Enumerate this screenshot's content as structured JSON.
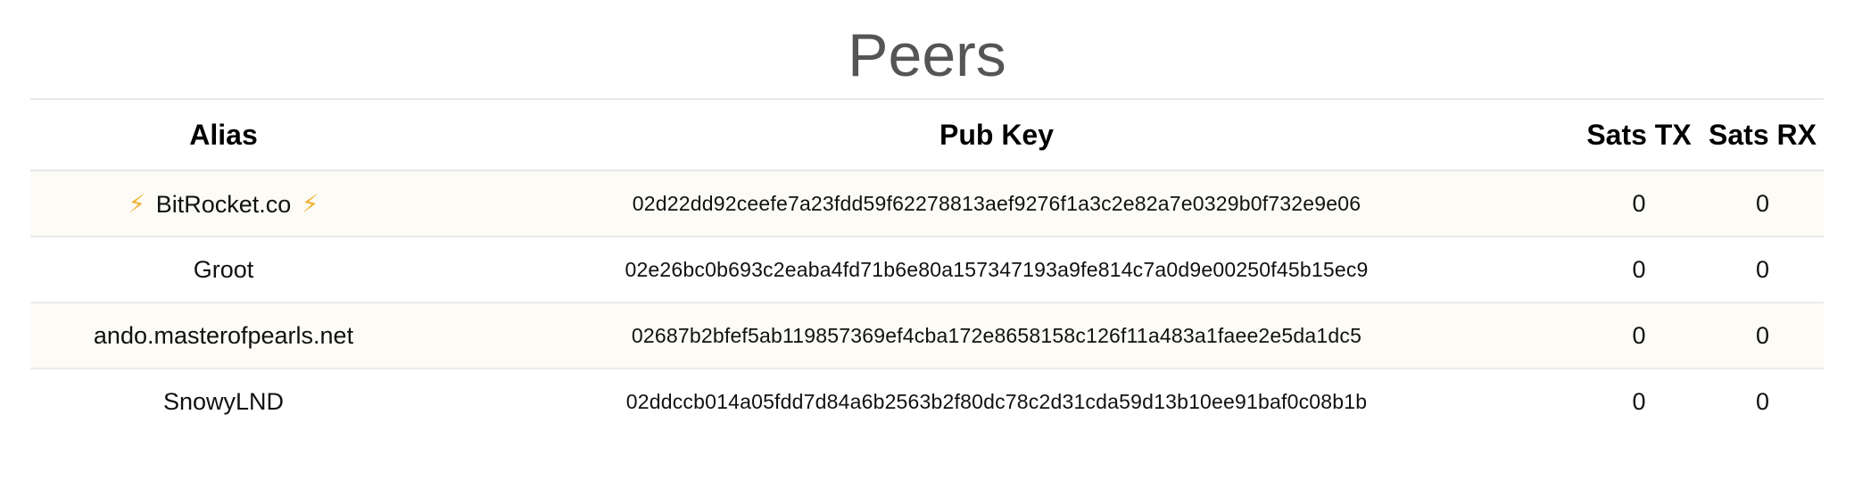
{
  "page": {
    "title": "Peers"
  },
  "table": {
    "headers": {
      "alias": "Alias",
      "pubkey": "Pub Key",
      "sats_tx": "Sats TX",
      "sats_rx": "Sats RX"
    },
    "rows": [
      {
        "alias_prefix_icon": "⚡",
        "alias": "BitRocket.co",
        "alias_suffix_icon": "⚡",
        "pubkey": "02d22dd92ceefe7a23fdd59f62278813aef9276f1a3c2e82a7e0329b0f732e9e06",
        "sats_tx": "0",
        "sats_rx": "0"
      },
      {
        "alias": "Groot",
        "pubkey": "02e26bc0b693c2eaba4fd71b6e80a157347193a9fe814c7a0d9e00250f45b15ec9",
        "sats_tx": "0",
        "sats_rx": "0"
      },
      {
        "alias": "ando.masterofpearls.net",
        "pubkey": "02687b2bfef5ab119857369ef4cba172e8658158c126f11a483a1faee2e5da1dc5",
        "sats_tx": "0",
        "sats_rx": "0"
      },
      {
        "alias": "SnowyLND",
        "pubkey": "02ddccb014a05fdd7d84a6b2563b2f80dc78c2d31cda59d13b10ee91baf0c08b1b",
        "sats_tx": "0",
        "sats_rx": "0"
      }
    ]
  },
  "colors": {
    "title": "#555555",
    "row_stripe": "#fdfbf6",
    "bolt": "#f0b43a",
    "divider": "#e8e8e8"
  }
}
